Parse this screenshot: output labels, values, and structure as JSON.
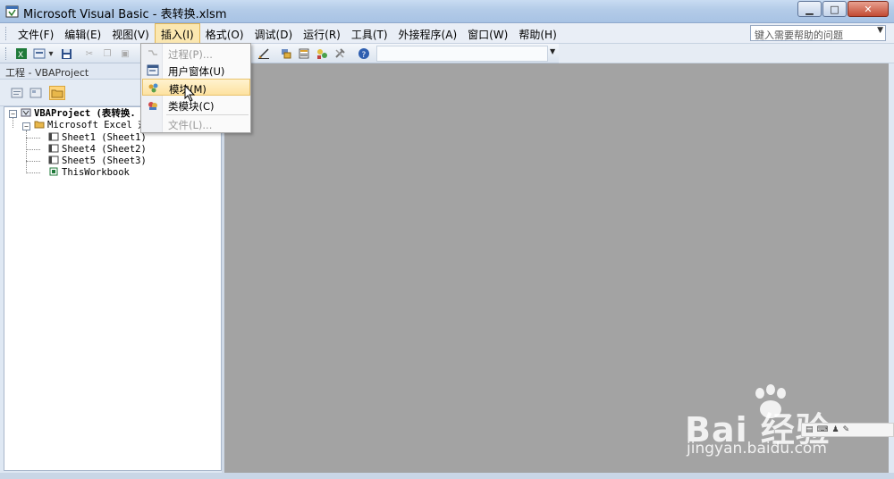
{
  "window": {
    "title": "Microsoft Visual Basic - 表转换.xlsm",
    "buttons": {
      "minimize": "▁",
      "maximize": "□",
      "close": "✕"
    }
  },
  "menubar": {
    "items": [
      "文件(F)",
      "编辑(E)",
      "视图(V)",
      "插入(I)",
      "格式(O)",
      "调试(D)",
      "运行(R)",
      "工具(T)",
      "外接程序(A)",
      "窗口(W)",
      "帮助(H)"
    ],
    "active_index": 3,
    "help_placeholder": "键入需要帮助的问题"
  },
  "insert_menu": {
    "items": [
      {
        "label": "过程(P)...",
        "enabled": false,
        "icon": "procedure-icon"
      },
      {
        "label": "用户窗体(U)",
        "enabled": true,
        "icon": "userform-icon"
      },
      {
        "label": "模块(M)",
        "enabled": true,
        "highlighted": true,
        "icon": "module-icon"
      },
      {
        "label": "类模块(C)",
        "enabled": true,
        "icon": "class-module-icon"
      },
      {
        "label": "文件(L)...",
        "enabled": false,
        "icon": ""
      }
    ]
  },
  "project_pane": {
    "title": "工程 - VBAProject",
    "tree": {
      "root": "VBAProject (表转换.",
      "folder": "Microsoft Excel 对",
      "items": [
        "Sheet1 (Sheet1)",
        "Sheet4 (Sheet2)",
        "Sheet5 (Sheet3)",
        "ThisWorkbook"
      ]
    }
  },
  "watermark": {
    "logo": "Bai 经验",
    "url": "jingyan.baidu.com"
  },
  "colors": {
    "workspace": "#a3a3a3",
    "menu_highlight": "#fde2a0",
    "titlebar": "#b3cbe8"
  }
}
